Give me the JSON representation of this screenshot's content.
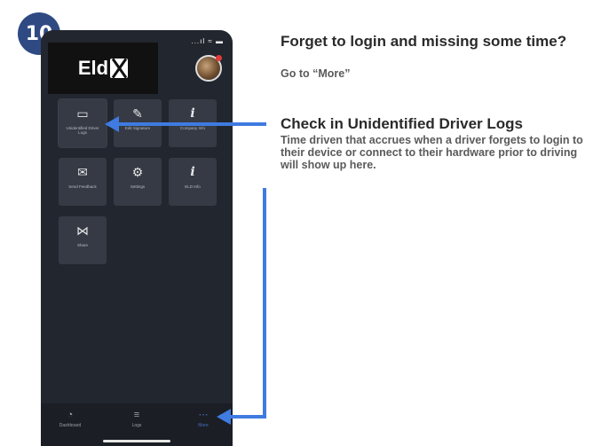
{
  "step": {
    "number": "10"
  },
  "phone": {
    "status_bar": "...ıl ≈ ▬",
    "logo": {
      "text": "Eld"
    },
    "tiles": [
      {
        "label": "Unidentified Driver Logs",
        "icon": "calendar-icon",
        "glyph": "▭"
      },
      {
        "label": "Edit Signature",
        "icon": "signature-icon",
        "glyph": "✎"
      },
      {
        "label": "Company Info",
        "icon": "info-icon",
        "glyph": "i"
      },
      {
        "label": "Send Feedback",
        "icon": "feedback-icon",
        "glyph": "✉"
      },
      {
        "label": "Settings",
        "icon": "settings-icon",
        "glyph": "⚙"
      },
      {
        "label": "ELD Info",
        "icon": "info-icon",
        "glyph": "i"
      },
      {
        "label": "Share",
        "icon": "share-icon",
        "glyph": "⋈"
      }
    ],
    "bottom_nav": [
      {
        "label": "Dashboard",
        "icon": "dashboard-icon",
        "glyph": "◔"
      },
      {
        "label": "Logs",
        "icon": "logs-icon",
        "glyph": "≡"
      },
      {
        "label": "More",
        "icon": "more-icon",
        "glyph": "⋯"
      }
    ]
  },
  "annotations": {
    "title_1": "Forget to login and missing some time?",
    "subtitle_1": "Go to “More”",
    "title_2": "Check in Unidentified Driver Logs",
    "body_2": "Time driven that accrues when a driver forgets to login to their device or connect to their hardware prior to driving will show up here."
  },
  "colors": {
    "badge": "#2f4a82",
    "arrow": "#3f7be0",
    "phone_bg": "#22262e",
    "tile_bg": "#353a44"
  }
}
